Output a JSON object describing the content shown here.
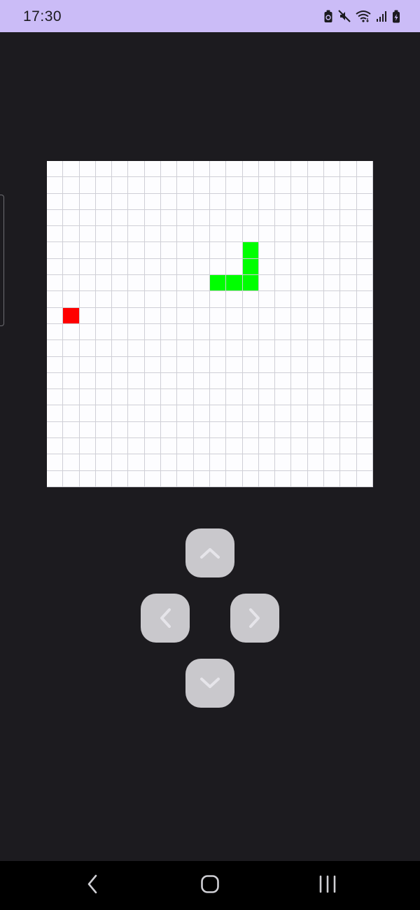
{
  "status_bar": {
    "time": "17:30",
    "background_color": "#cbbcf7",
    "icons": [
      "battery-saver-icon",
      "mute-icon",
      "wifi-icon",
      "cell-signal-icon",
      "battery-charging-icon"
    ]
  },
  "game": {
    "grid_columns": 20,
    "grid_rows": 20,
    "snake_color": "#00ff00",
    "food_color": "#ff0000",
    "board_color": "#fdfdff",
    "snake_cells": [
      [
        12,
        5
      ],
      [
        12,
        6
      ],
      [
        12,
        7
      ],
      [
        11,
        7
      ],
      [
        10,
        7
      ]
    ],
    "food_cell": [
      1,
      9
    ]
  },
  "controls": {
    "up": "chevron-up-icon",
    "left": "chevron-left-icon",
    "right": "chevron-right-icon",
    "down": "chevron-down-icon",
    "button_color": "#c9c8cc"
  },
  "nav_bar": {
    "back": "back-icon",
    "home": "home-icon",
    "recents": "recents-icon"
  }
}
